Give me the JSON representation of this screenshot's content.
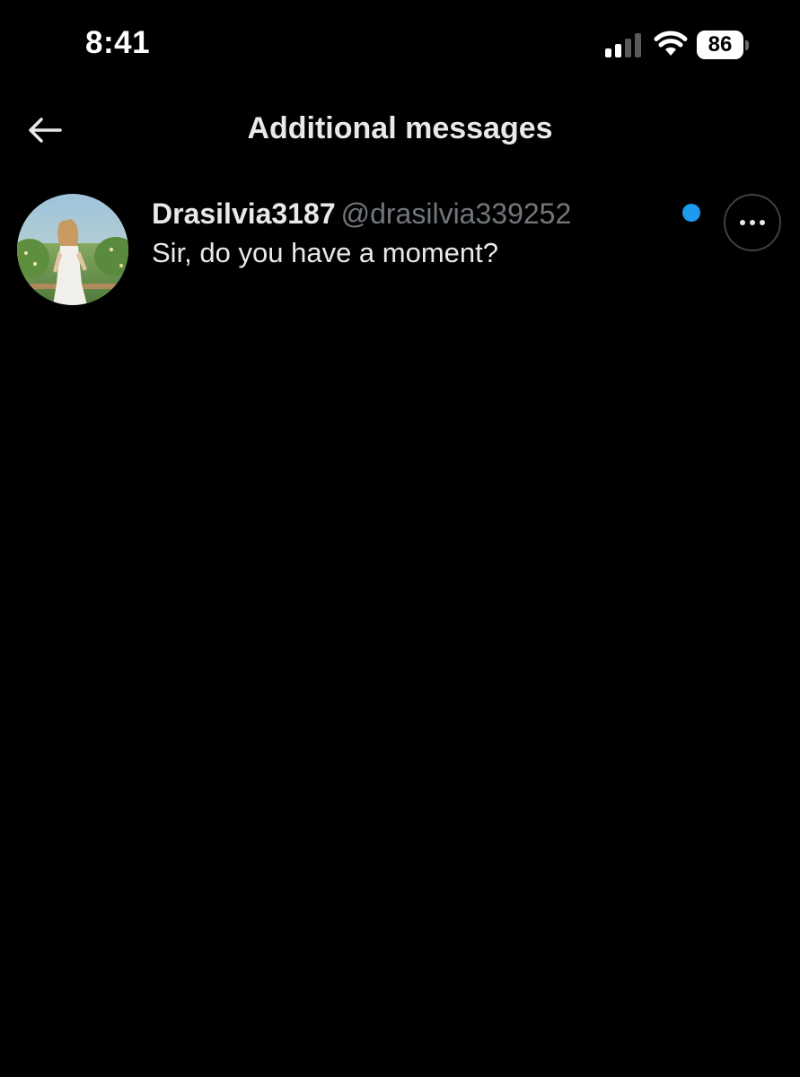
{
  "status_bar": {
    "time": "8:41",
    "battery_level": "86",
    "icons": [
      "signal-icon",
      "wifi-icon",
      "battery-icon"
    ]
  },
  "header": {
    "title": "Additional messages",
    "back_icon": "arrow-left-icon"
  },
  "conversations": [
    {
      "display_name": "Drasilvia3187",
      "handle": "@drasilvia339252",
      "preview": "Sir, do you have a moment?",
      "unread": true,
      "more_icon": "more-horizontal-icon"
    }
  ],
  "colors": {
    "background": "#000000",
    "text_primary": "#e7e9ea",
    "text_secondary": "#71767b",
    "accent": "#1d9bf0"
  }
}
